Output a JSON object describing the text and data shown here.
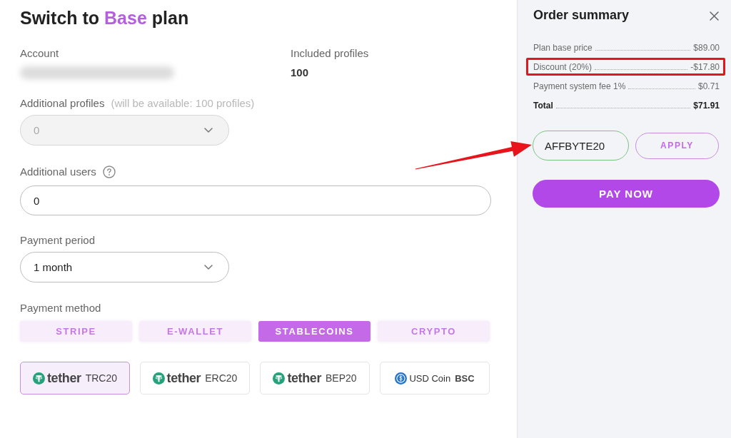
{
  "main": {
    "title": [
      {
        "text": "Switch to",
        "accent": false
      },
      {
        "text": "Base",
        "accent": true
      },
      {
        "text": "plan",
        "accent": false
      }
    ],
    "account": {
      "label": "Account",
      "redacted": true
    },
    "included_profiles": {
      "label": "Included profiles",
      "value": "100"
    },
    "additional_profiles": {
      "label": "Additional profiles",
      "hint": "(will be available: 100 profiles)",
      "value": "0",
      "disabled": true
    },
    "additional_users": {
      "label": "Additional users",
      "value": "0",
      "help": true
    },
    "payment_period": {
      "label": "Payment period",
      "value": "1 month",
      "disabled": false
    },
    "payment_method": {
      "label": "Payment method",
      "tabs": [
        {
          "label": "STRIPE",
          "selected": false
        },
        {
          "label": "E-WALLET",
          "selected": false
        },
        {
          "label": "STABLECOINS",
          "selected": true
        },
        {
          "label": "CRYPTO",
          "selected": false
        }
      ],
      "options": [
        {
          "kind": "tether",
          "brand": "tether",
          "network": "TRC20",
          "selected": true
        },
        {
          "kind": "tether",
          "brand": "tether",
          "network": "ERC20",
          "selected": false
        },
        {
          "kind": "tether",
          "brand": "tether",
          "network": "BEP20",
          "selected": false
        },
        {
          "kind": "usdc",
          "brand": "USD Coin",
          "network": "BSC",
          "selected": false
        }
      ]
    }
  },
  "summary": {
    "title": "Order summary",
    "rows": [
      {
        "kind": "item",
        "label": "Plan base price",
        "value": "$89.00",
        "highlighted": false
      },
      {
        "kind": "item",
        "label": "Discount (20%)",
        "value": "-$17.80",
        "highlighted": true
      },
      {
        "kind": "item",
        "label": "Payment system fee 1%",
        "value": "$0.71",
        "highlighted": false
      },
      {
        "kind": "total",
        "label": "Total",
        "value": "$71.91",
        "highlighted": false
      }
    ],
    "coupon": {
      "value": "AFFBYTE20",
      "valid": true,
      "pointed_at": true
    },
    "apply_button": "APPLY",
    "pay_button": "PAY NOW"
  }
}
